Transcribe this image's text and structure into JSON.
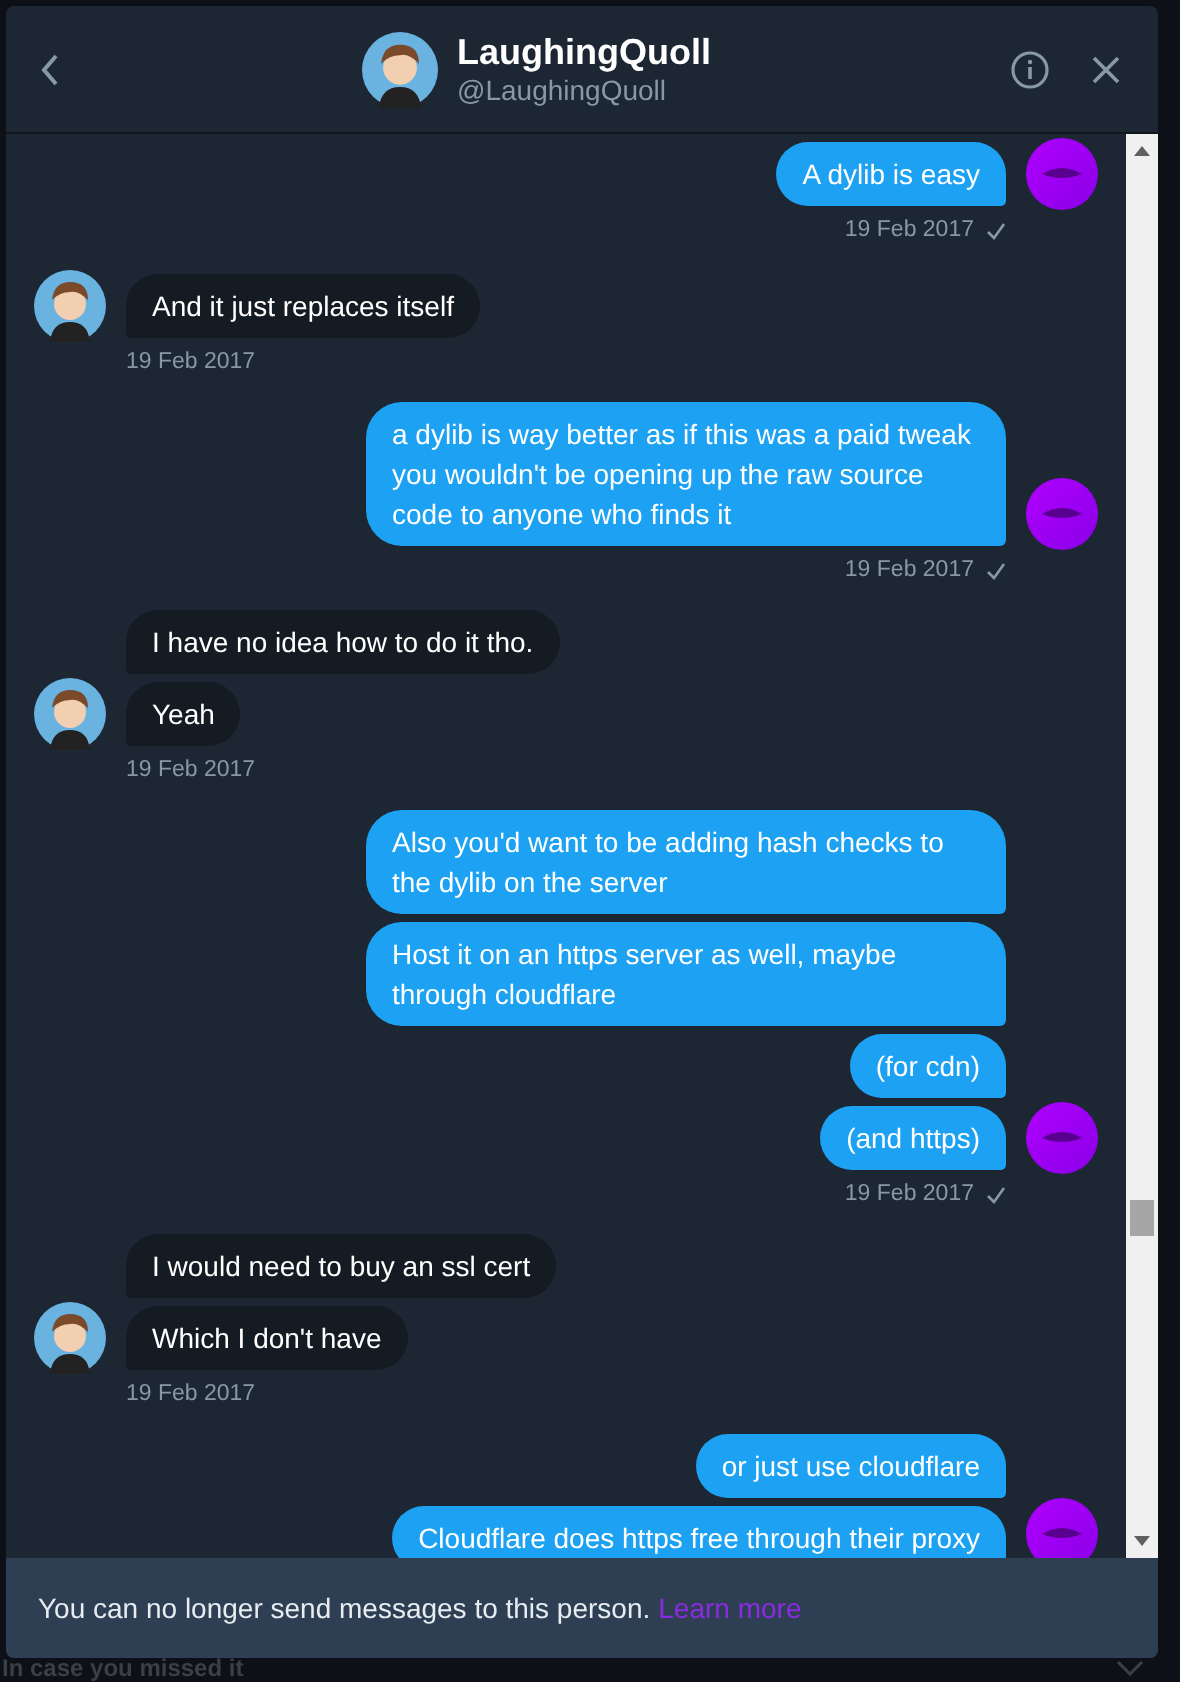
{
  "header": {
    "title": "LaughingQuoll",
    "handle": "@LaughingQuoll"
  },
  "groups": [
    {
      "kind": "sent",
      "messages": [
        "A dylib is easy"
      ],
      "time": "19 Feb 2017",
      "delivered": true
    },
    {
      "kind": "received",
      "messages": [
        "And it just replaces itself"
      ],
      "time": "19 Feb 2017"
    },
    {
      "kind": "sent",
      "messages": [
        "a dylib is way better as if this was a paid tweak you wouldn't be opening up the raw source code to anyone who finds it"
      ],
      "time": "19 Feb 2017",
      "delivered": true
    },
    {
      "kind": "received",
      "messages": [
        "I have no idea how to do it tho.",
        "Yeah"
      ],
      "time": "19 Feb 2017"
    },
    {
      "kind": "sent",
      "messages": [
        "Also you'd want to be adding hash checks to the dylib on the server",
        "Host it on an https server as well, maybe through cloudflare",
        "(for cdn)",
        "(and https)"
      ],
      "time": "19 Feb 2017",
      "delivered": true
    },
    {
      "kind": "received",
      "messages": [
        "I would need to buy an ssl cert",
        "Which I don't have"
      ],
      "time": "19 Feb 2017"
    },
    {
      "kind": "sent",
      "messages": [
        "or just use cloudflare",
        "Cloudflare does https free through their proxy"
      ]
    }
  ],
  "notice": {
    "text": "You can no longer send messages to this person.",
    "link": "Learn more"
  },
  "background": {
    "heading": "In case you missed it"
  }
}
